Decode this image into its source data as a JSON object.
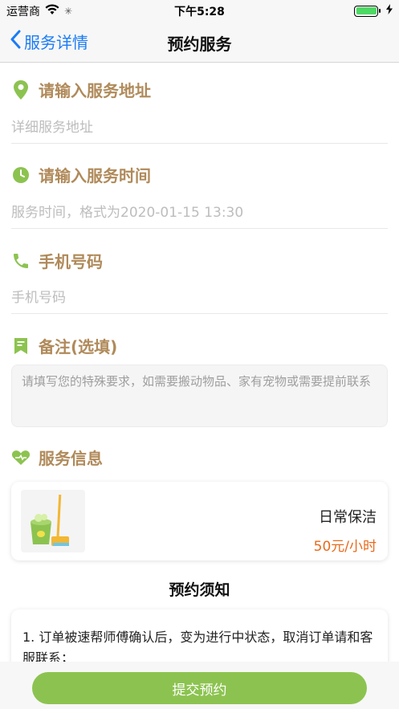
{
  "status_bar": {
    "carrier": "运营商",
    "time": "下午5:28",
    "battery_level": 1.0
  },
  "nav": {
    "back_label": "服务详情",
    "title": "预约服务"
  },
  "form": {
    "address": {
      "label": "请输入服务地址",
      "placeholder": "详细服务地址",
      "value": ""
    },
    "time": {
      "label": "请输入服务时间",
      "placeholder": "服务时间，格式为2020-01-15 13:30",
      "value": ""
    },
    "phone": {
      "label": "手机号码",
      "placeholder": "手机号码",
      "value": ""
    },
    "notes": {
      "label": "备注(选填)",
      "placeholder": "请填写您的特殊要求，如需要搬动物品、家有宠物或需要提前联系",
      "value": ""
    }
  },
  "service_info": {
    "label": "服务信息",
    "name": "日常保洁",
    "price": "50元/小时"
  },
  "notice": {
    "title": "预约须知",
    "text": "1. 订单被速帮师傅确认后，变为进行中状态，取消订单请和客服联系；"
  },
  "submit_label": "提交预约",
  "colors": {
    "accent_label": "#b08a5a",
    "icon_green": "#8cc350",
    "price": "#e86a1c",
    "link_blue": "#1a7cf5"
  },
  "icons": {
    "address": "location-pin-icon",
    "time": "clock-icon",
    "phone": "phone-icon",
    "notes": "note-icon",
    "service": "heart-icon",
    "service_image": "mop-bucket-icon"
  }
}
